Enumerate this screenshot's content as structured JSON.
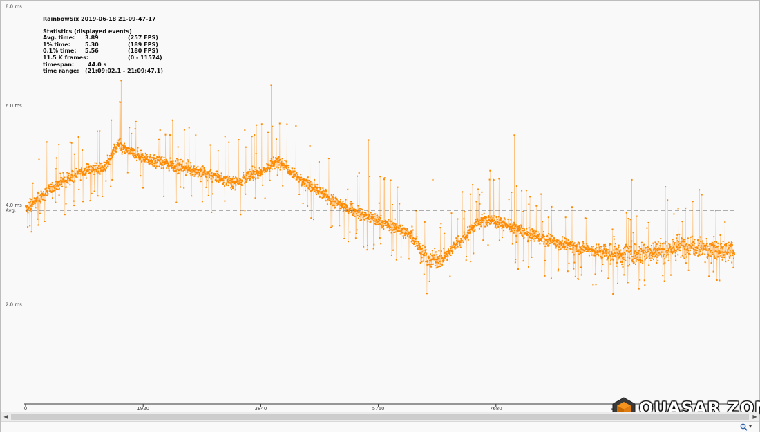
{
  "stats": {
    "title": "RainbowSix 2019-06-18 21-09-47-17",
    "heading": "Statistics (displayed events)",
    "rows": [
      [
        "Avg. time:",
        "3.89",
        "(257 FPS)"
      ],
      [
        "1% time:",
        "5.30",
        "(189 FPS)"
      ],
      [
        "0.1% time:",
        "5.56",
        "(180 FPS)"
      ],
      [
        "11.5 K frames:",
        "",
        "(0 - 11574)"
      ],
      [
        "timespan:",
        "44.0 s",
        ""
      ],
      [
        "time range:",
        "(21:09:02.1 - 21:09:47.1)",
        ""
      ]
    ]
  },
  "chart_data": {
    "type": "scatter",
    "x_range": [
      0,
      11574
    ],
    "y_range": [
      0,
      8.0
    ],
    "ytick_values": [
      2.0,
      4.0,
      6.0,
      8.0
    ],
    "ytick_labels": [
      "2.0 ms",
      "4.0 ms",
      "6.0 ms",
      "8.0 ms"
    ],
    "xtick_values": [
      0,
      1920,
      3840,
      5760,
      7680,
      9600
    ],
    "xtick_labels": [
      "0",
      "1920",
      "3840",
      "5760",
      "7680",
      "96"
    ],
    "avg_line": {
      "value": 3.89,
      "label": "Avg."
    },
    "series_color": "#ff8a00",
    "trend": {
      "x": [
        0,
        500,
        1000,
        1300,
        1500,
        1800,
        2200,
        2600,
        3000,
        3400,
        3900,
        4150,
        4500,
        5000,
        5500,
        6300,
        6550,
        6800,
        7000,
        7350,
        7500,
        7750,
        8200,
        8800,
        9400,
        9900,
        10400,
        10900,
        11574
      ],
      "y": [
        3.9,
        4.4,
        4.7,
        4.75,
        5.2,
        5.0,
        4.85,
        4.75,
        4.6,
        4.45,
        4.7,
        4.9,
        4.5,
        4.1,
        3.8,
        3.4,
        2.9,
        2.9,
        3.15,
        3.6,
        3.7,
        3.65,
        3.4,
        3.2,
        3.05,
        3.0,
        3.1,
        3.2,
        3.0
      ]
    },
    "spikes": [
      {
        "x": 1560,
        "y": 6.5
      },
      {
        "x": 1400,
        "y": 5.7
      },
      {
        "x": 2400,
        "y": 5.7
      },
      {
        "x": 3580,
        "y": 5.5
      },
      {
        "x": 4010,
        "y": 6.4
      },
      {
        "x": 5600,
        "y": 5.3
      },
      {
        "x": 6650,
        "y": 4.5
      },
      {
        "x": 7300,
        "y": 4.4
      },
      {
        "x": 7980,
        "y": 5.4
      },
      {
        "x": 7450,
        "y": 4.25
      },
      {
        "x": 9900,
        "y": 4.5
      },
      {
        "x": 11000,
        "y": 4.3
      }
    ]
  },
  "watermark": {
    "text": "QUASAR ZONE"
  },
  "zoom": {
    "icon": "zoom-icon",
    "dropdown": "▾"
  },
  "scrollbar": {
    "left_icon": "◀",
    "right_icon": "▶"
  }
}
